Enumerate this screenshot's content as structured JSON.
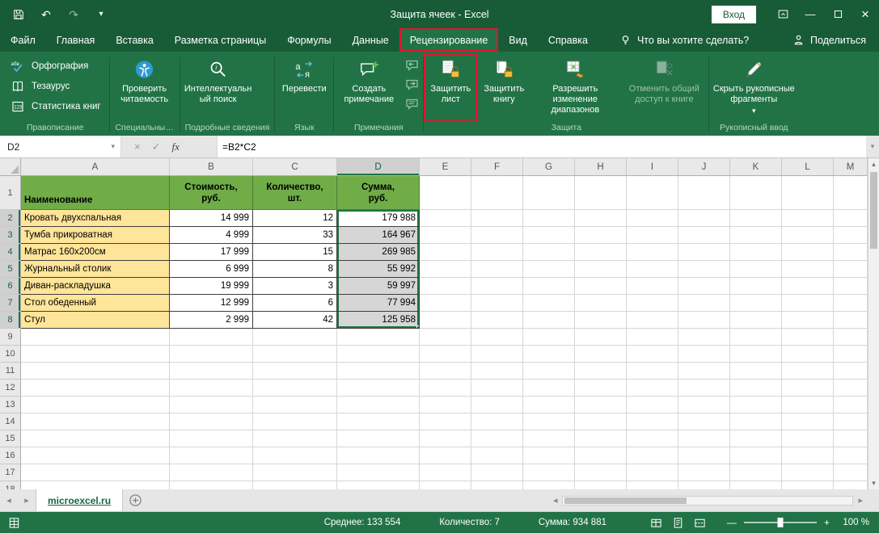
{
  "titlebar": {
    "title": "Защита ячеек - Excel",
    "signin_label": "Вход"
  },
  "ribbon_tabs": {
    "items": [
      {
        "id": "file",
        "label": "Файл"
      },
      {
        "id": "home",
        "label": "Главная"
      },
      {
        "id": "insert",
        "label": "Вставка"
      },
      {
        "id": "page-layout",
        "label": "Разметка страницы"
      },
      {
        "id": "formulas",
        "label": "Формулы"
      },
      {
        "id": "data",
        "label": "Данные"
      },
      {
        "id": "review",
        "label": "Рецензирование",
        "active": true,
        "annotated": true
      },
      {
        "id": "view",
        "label": "Вид"
      },
      {
        "id": "help",
        "label": "Справка"
      }
    ],
    "tellme_label": "Что вы хотите сделать?",
    "share_label": "Поделиться"
  },
  "ribbon": {
    "groups": [
      {
        "id": "proofing",
        "label": "Правописание",
        "type": "small",
        "buttons": [
          {
            "id": "spelling",
            "label": "Орфография",
            "icon": "spelling-icon"
          },
          {
            "id": "thesaurus",
            "label": "Тезаурус",
            "icon": "thesaurus-icon"
          },
          {
            "id": "book-statistics",
            "label": "Статистика книг",
            "icon": "book-statistics-icon"
          }
        ]
      },
      {
        "id": "accessibility",
        "label": "Специальны…",
        "type": "large",
        "buttons": [
          {
            "id": "check-accessibility",
            "label": "Проверить читаемость",
            "icon": "accessibility-checker-icon"
          }
        ]
      },
      {
        "id": "insights",
        "label": "Подробные сведения",
        "type": "large",
        "buttons": [
          {
            "id": "smart-lookup",
            "label": "Интеллектуальный поиск",
            "icon": "smart-lookup-icon"
          }
        ]
      },
      {
        "id": "language",
        "label": "Язык",
        "type": "large",
        "buttons": [
          {
            "id": "translate",
            "label": "Перевести",
            "icon": "translate-icon"
          }
        ]
      },
      {
        "id": "comments",
        "label": "Примечания",
        "type": "large",
        "buttons": [
          {
            "id": "new-comment",
            "label": "Создать примечание",
            "icon": "new-comment-icon"
          }
        ],
        "extra_icons": [
          "previous-comment-icon",
          "next-comment-icon",
          "show-comments-icon"
        ]
      },
      {
        "id": "protect",
        "label": "Защита",
        "type": "large",
        "buttons": [
          {
            "id": "protect-sheet",
            "label": "Защитить лист",
            "icon": "protect-sheet-icon",
            "annotated": true
          },
          {
            "id": "protect-workbook",
            "label": "Защитить книгу",
            "icon": "protect-workbook-icon"
          },
          {
            "id": "allow-edit-ranges",
            "label": "Разрешить изменение диапазонов",
            "icon": "allow-edit-ranges-icon"
          },
          {
            "id": "unshare-workbook",
            "label": "Отменить общий доступ к книге",
            "icon": "unshare-workbook-icon",
            "disabled": true
          }
        ]
      },
      {
        "id": "ink",
        "label": "Рукописный ввод",
        "type": "large",
        "buttons": [
          {
            "id": "hide-ink",
            "label": "Скрыть рукописные фрагменты",
            "icon": "hide-ink-icon",
            "dropdown": true
          }
        ]
      }
    ]
  },
  "formula_bar": {
    "name_box": "D2",
    "formula": "=B2*C2"
  },
  "sheet": {
    "columns": [
      "A",
      "B",
      "C",
      "D",
      "E",
      "F",
      "G",
      "H",
      "I",
      "J",
      "K",
      "L",
      "M"
    ],
    "visible_rows": 18,
    "selection": {
      "range": "D2:D8",
      "active_cell": "D2",
      "selected_column": "D",
      "selected_rows": [
        2,
        3,
        4,
        5,
        6,
        7,
        8
      ]
    },
    "table": {
      "headers": [
        "Наименование",
        "Стоимость,\nруб.",
        "Количество,\nшт.",
        "Сумма,\nруб."
      ],
      "rows": [
        [
          "Кровать двухспальная",
          "14 999",
          "12",
          "179 988"
        ],
        [
          "Тумба прикроватная",
          "4 999",
          "33",
          "164 967"
        ],
        [
          "Матрас 160х200см",
          "17 999",
          "15",
          "269 985"
        ],
        [
          "Журнальный столик",
          "6 999",
          "8",
          "55 992"
        ],
        [
          "Диван-раскладушка",
          "19 999",
          "3",
          "59 997"
        ],
        [
          "Стол обеденный",
          "12 999",
          "6",
          "77 994"
        ],
        [
          "Стул",
          "2 999",
          "42",
          "125 958"
        ]
      ]
    }
  },
  "sheet_bar": {
    "tabs": [
      {
        "label": "microexcel.ru",
        "active": true
      }
    ]
  },
  "status_bar": {
    "stats": [
      "Среднее: 133 554",
      "Количество: 7",
      "Сумма: 934 881"
    ],
    "zoom_label": "100 %"
  },
  "colors": {
    "title_green": "#185c37",
    "ribbon_green": "#217346",
    "accent_red": "#e8112d",
    "header_green": "#70ad47",
    "header_border": "#507e32",
    "cell_yellow": "#ffe599",
    "cell_border": "#3f3f3f",
    "selection_fill": "#d6d6d6",
    "selection_border": "#217346"
  }
}
